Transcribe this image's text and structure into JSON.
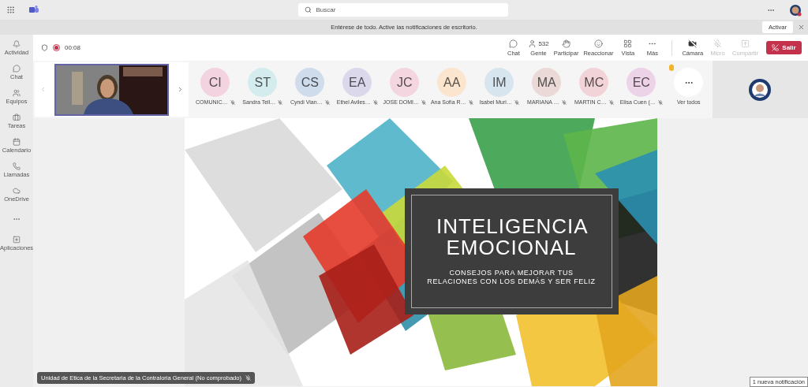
{
  "top_bar": {
    "search_placeholder": "Buscar"
  },
  "notification_bar": {
    "message": "Entérese de todo. Active las notificaciones de escritorio.",
    "button": "Activar"
  },
  "rail": [
    {
      "kind": "bell",
      "label": "Actividad"
    },
    {
      "kind": "chat",
      "label": "Chat"
    },
    {
      "kind": "teams",
      "label": "Equipos"
    },
    {
      "kind": "tasks",
      "label": "Tareas"
    },
    {
      "kind": "calendar",
      "label": "Calendario"
    },
    {
      "kind": "calls",
      "label": "Llamadas"
    },
    {
      "kind": "cloud",
      "label": "OneDrive"
    },
    {
      "kind": "more"
    },
    {
      "kind": "apps",
      "label": "Aplicaciones"
    }
  ],
  "meeting_toolbar": {
    "timer": "00:08",
    "recording": true,
    "actions": [
      {
        "kind": "chat",
        "label": "Chat",
        "disabled": false
      },
      {
        "kind": "people",
        "label": "Gente",
        "count": "532",
        "disabled": false
      },
      {
        "kind": "hand",
        "label": "Participar",
        "disabled": false
      },
      {
        "kind": "react",
        "label": "Reaccionar",
        "disabled": false
      },
      {
        "kind": "view",
        "label": "Vista",
        "disabled": false
      },
      {
        "kind": "more",
        "label": "Más",
        "disabled": false
      },
      {
        "kind": "camera",
        "label": "Cámara",
        "disabled": false
      },
      {
        "kind": "mic",
        "label": "Micro",
        "disabled": true
      },
      {
        "kind": "share",
        "label": "Compartir",
        "disabled": true
      }
    ],
    "leave": "Salir"
  },
  "participants": [
    {
      "initials": "CI",
      "name": "COMUNIC…",
      "color": "#f2d3df"
    },
    {
      "initials": "ST",
      "name": "Sandra Tell…",
      "color": "#d5ecef"
    },
    {
      "initials": "CS",
      "name": "Cyndi Vian…",
      "color": "#cfdcec"
    },
    {
      "initials": "EA",
      "name": "Ethel Aviles…",
      "color": "#dcd8ec"
    },
    {
      "initials": "JC",
      "name": "JOSE DOMI…",
      "color": "#f4d6e0"
    },
    {
      "initials": "AA",
      "name": "Ana Sofía R…",
      "color": "#fbe5cf"
    },
    {
      "initials": "IM",
      "name": "Isabel Muri…",
      "color": "#d7e5ee"
    },
    {
      "initials": "MA",
      "name": "MARIANA …",
      "color": "#ead9d6"
    },
    {
      "initials": "MC",
      "name": "MARTIN C…",
      "color": "#f2d3d8"
    },
    {
      "initials": "EC",
      "name": "Elisa Cuen (…",
      "color": "#ecd3e8"
    }
  ],
  "see_all": {
    "label": "Ver todos",
    "hand_raised": true
  },
  "slide": {
    "title": "INTELIGENCIA EMOCIONAL",
    "subtitle": "CONSEJOS PARA MEJORAR TUS RELACIONES CON LOS DEMÁS Y SER FELIZ"
  },
  "name_tag": {
    "text": "Unidad de Etica de la Secretaria de la Contraloria General (No comprobado)",
    "muted": true
  },
  "toast": "1 nueva notificación"
}
